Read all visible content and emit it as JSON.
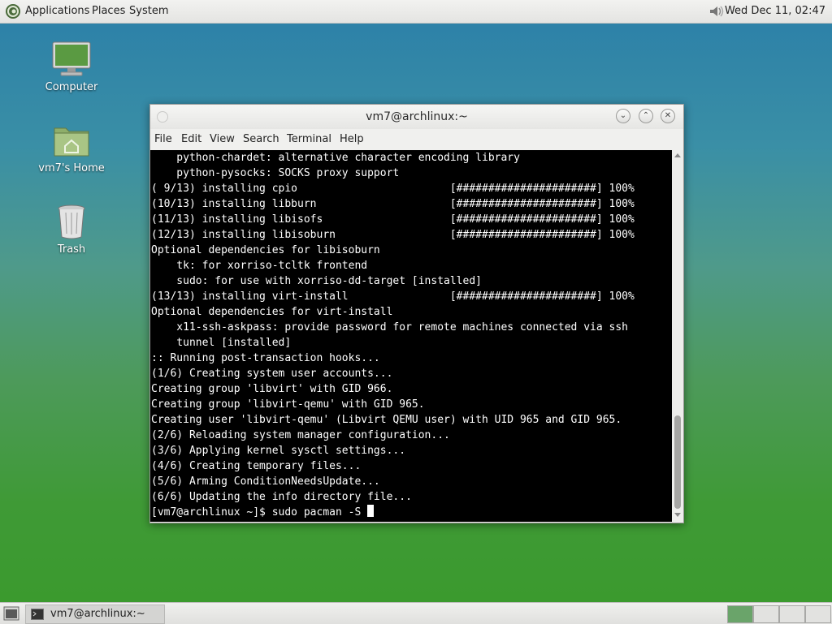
{
  "top_panel": {
    "menu": [
      "Applications",
      "Places",
      "System"
    ],
    "clock": "Wed Dec 11, 02:47"
  },
  "desktop": {
    "icons": [
      {
        "label": "Computer",
        "icon": "computer-icon"
      },
      {
        "label": "vm7's Home",
        "icon": "home-folder-icon"
      },
      {
        "label": "Trash",
        "icon": "trash-icon"
      }
    ]
  },
  "window": {
    "title": "vm7@archlinux:~",
    "menu": [
      "File",
      "Edit",
      "View",
      "Search",
      "Terminal",
      "Help"
    ],
    "terminal_lines": [
      "    python-chardet: alternative character encoding library",
      "    python-pysocks: SOCKS proxy support",
      "( 9/13) installing cpio                        [######################] 100%",
      "(10/13) installing libburn                     [######################] 100%",
      "(11/13) installing libisofs                    [######################] 100%",
      "(12/13) installing libisoburn                  [######################] 100%",
      "Optional dependencies for libisoburn",
      "    tk: for xorriso-tcltk frontend",
      "    sudo: for use with xorriso-dd-target [installed]",
      "(13/13) installing virt-install                [######################] 100%",
      "Optional dependencies for virt-install",
      "    x11-ssh-askpass: provide password for remote machines connected via ssh",
      "    tunnel [installed]",
      ":: Running post-transaction hooks...",
      "(1/6) Creating system user accounts...",
      "Creating group 'libvirt' with GID 966.",
      "Creating group 'libvirt-qemu' with GID 965.",
      "Creating user 'libvirt-qemu' (Libvirt QEMU user) with UID 965 and GID 965.",
      "(2/6) Reloading system manager configuration...",
      "(3/6) Applying kernel sysctl settings...",
      "(4/6) Creating temporary files...",
      "(5/6) Arming ConditionNeedsUpdate...",
      "(6/6) Updating the info directory file..."
    ],
    "prompt": "[vm7@archlinux ~]$ sudo pacman -S "
  },
  "taskbar": {
    "task_label": "vm7@archlinux:~"
  }
}
